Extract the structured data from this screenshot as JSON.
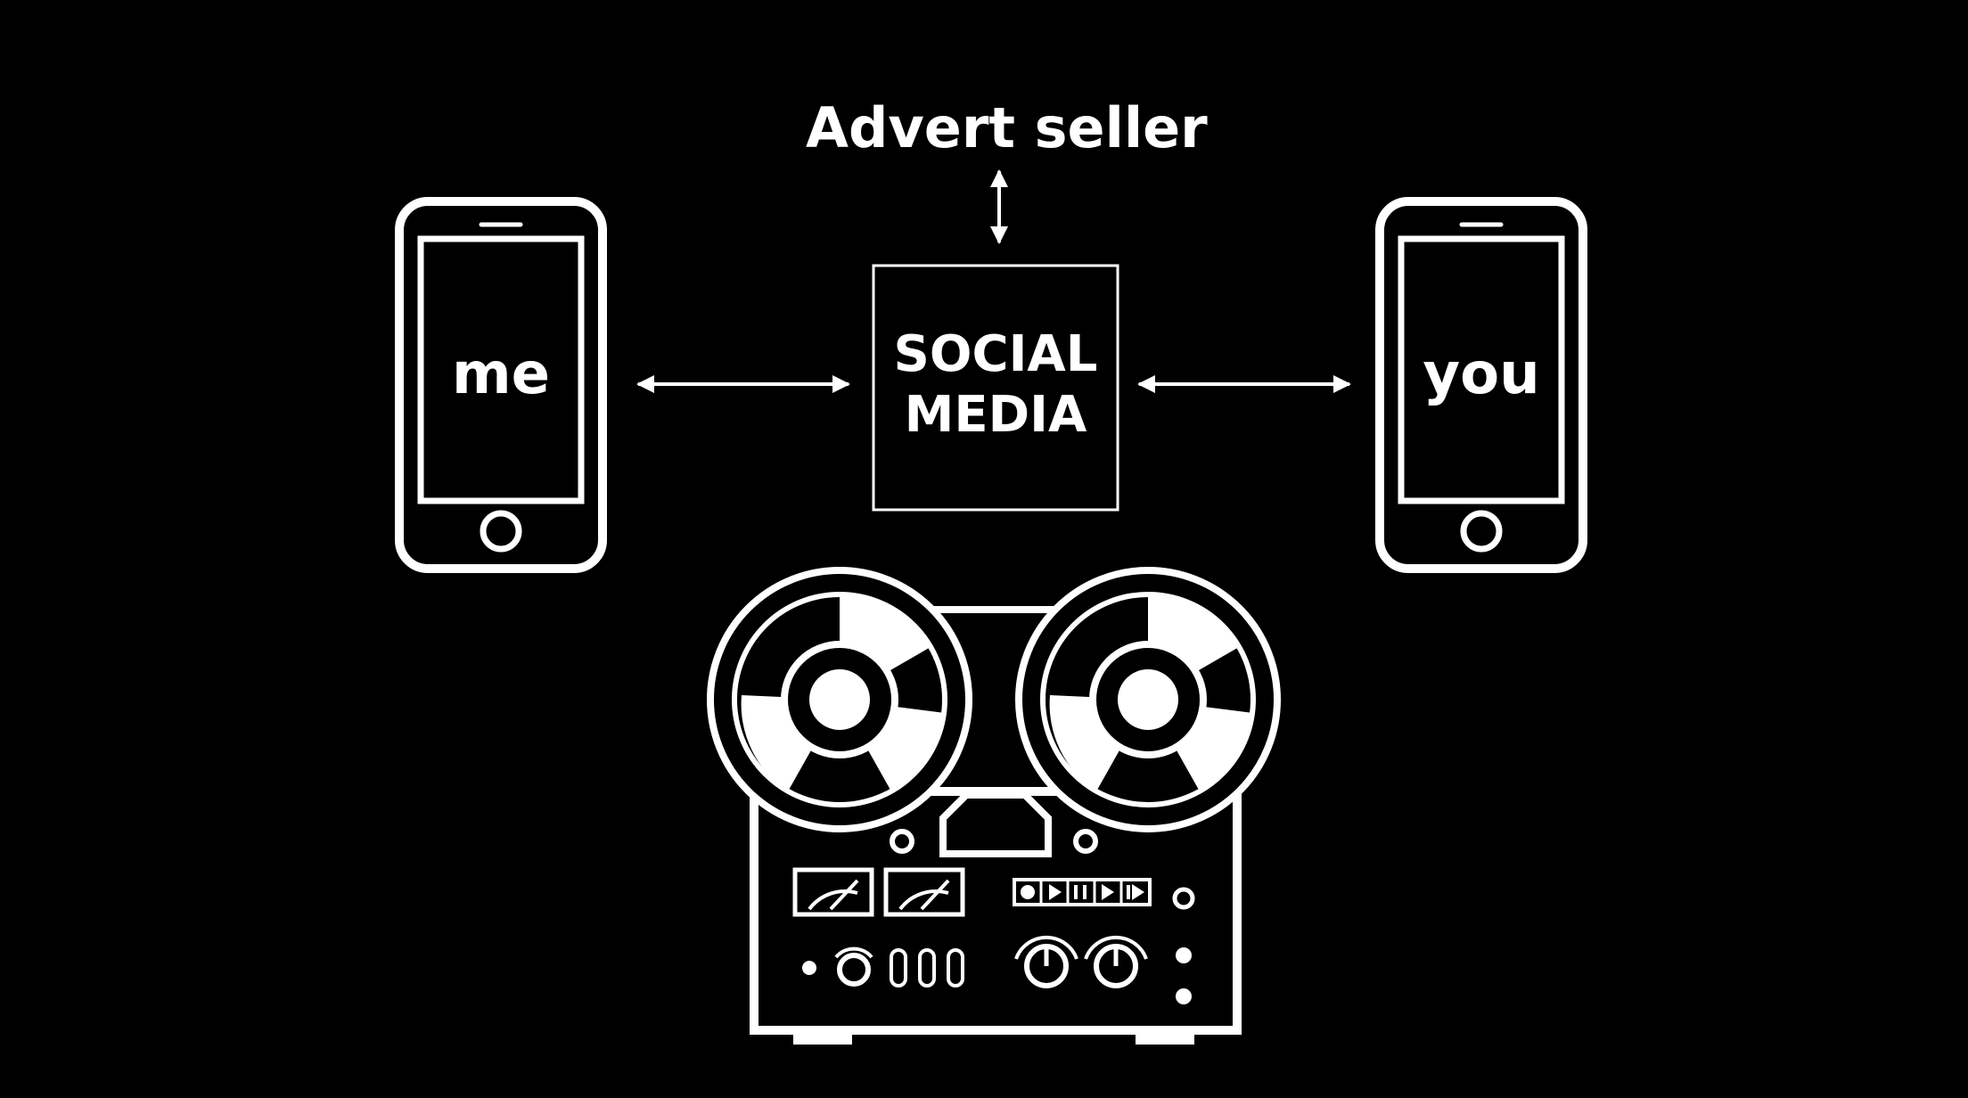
{
  "nodes": {
    "advert_seller": "Advert seller",
    "me": "me",
    "you": "you",
    "social_media": [
      "SOCIAL",
      "MEDIA"
    ]
  },
  "icons": {
    "left_phone": "smartphone-icon",
    "right_phone": "smartphone-icon",
    "recorder": "reel-to-reel-tape-recorder-icon",
    "arrows": "double-headed-arrow-icon"
  },
  "colors": {
    "background": "#000000",
    "foreground": "#ffffff"
  }
}
